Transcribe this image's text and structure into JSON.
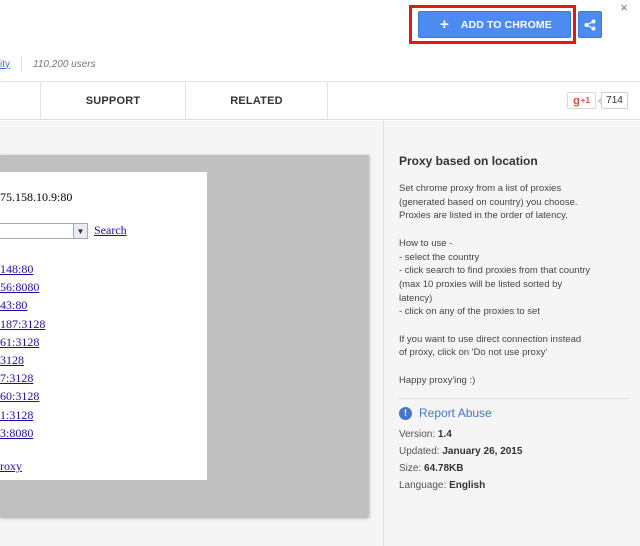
{
  "header": {
    "close_glyph": "×",
    "add_button_label": "ADD TO CHROME",
    "add_button_plus": "+",
    "meta_link_fragment": "ity",
    "users": "110,200 users",
    "accent_color": "#4d8bf0",
    "highlight_color": "#e8141c"
  },
  "tabs": {
    "support": "SUPPORT",
    "related": "RELATED"
  },
  "social": {
    "gplus_label": "g",
    "gplus_sup": "+1",
    "count": "714"
  },
  "screenshot": {
    "ip_text": "75.158.10.9:80",
    "search_link": "Search",
    "proxies": [
      "148:80",
      "56:8080",
      "43:80",
      "187:3128",
      "61:3128",
      "3128",
      "7:3128",
      "60:3128",
      "1:3128",
      "3:8080"
    ],
    "no_proxy_link": "roxy"
  },
  "details": {
    "title": "Proxy based on location",
    "description_lines": [
      "Set chrome proxy from a list of proxies",
      "(generated based on country) you choose.",
      "Proxies are listed in the order of latency."
    ],
    "howto_lines": [
      "How to use -",
      "- select the country",
      "- click search to find proxies from that country",
      "(max 10 proxies will be listed sorted by",
      "latency)",
      "- click on any of the proxies to set"
    ],
    "direct_lines": [
      "If you want to use direct connection instead",
      "of proxy, click on 'Do not use proxy'"
    ],
    "happy": "Happy proxy'ing :)",
    "report_abuse": "Report Abuse",
    "report_icon": "!",
    "version_label": "Version:",
    "version_value": "1.4",
    "updated_label": "Updated:",
    "updated_value": "January 26, 2015",
    "size_label": "Size:",
    "size_value": "64.78KB",
    "language_label": "Language:",
    "language_value": "English"
  }
}
